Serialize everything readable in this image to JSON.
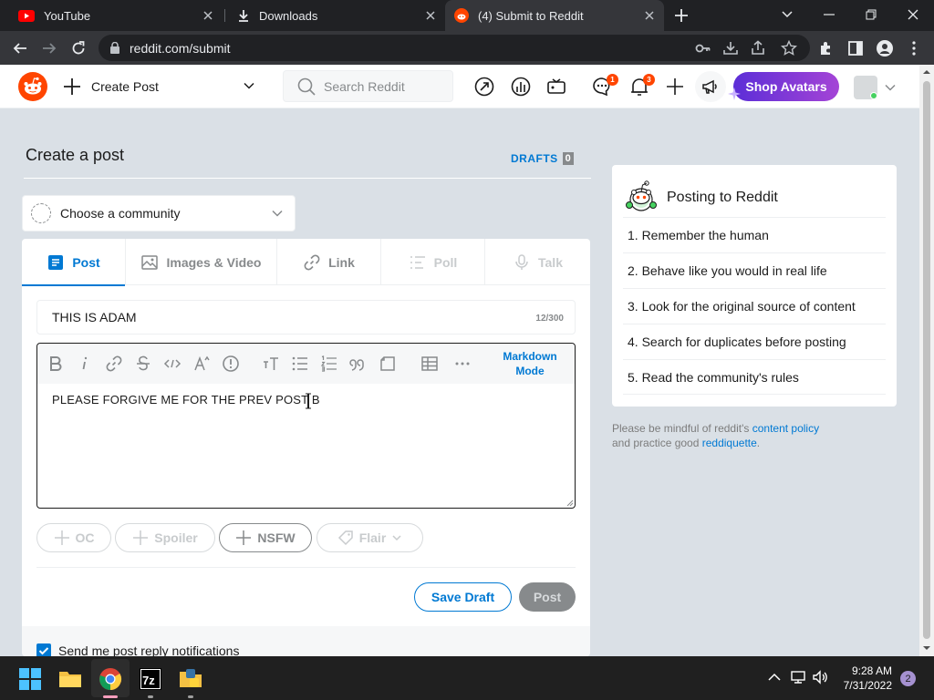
{
  "browser": {
    "tabs": [
      {
        "title": "YouTube",
        "icon": "youtube-icon"
      },
      {
        "title": "Downloads",
        "icon": "download-icon"
      },
      {
        "title": "(4) Submit to Reddit",
        "icon": "reddit-icon",
        "active": true
      }
    ],
    "url": "reddit.com/submit"
  },
  "header": {
    "create_post": "Create Post",
    "search_placeholder": "Search Reddit",
    "chat_badge": "1",
    "notif_badge": "3",
    "shop_avatars": "Shop Avatars"
  },
  "main": {
    "page_title": "Create a post",
    "drafts_label": "DRAFTS",
    "drafts_count": "0",
    "community_placeholder": "Choose a community",
    "tabs": [
      "Post",
      "Images & Video",
      "Link",
      "Poll",
      "Talk"
    ],
    "title_value": "THIS IS ADAM",
    "title_count": "12/300",
    "markdown_mode": "Markdown Mode",
    "body_text": "PLEASE FORGIVE ME FOR THE PREV POST B",
    "tags": [
      "OC",
      "Spoiler",
      "NSFW",
      "Flair"
    ],
    "save_draft": "Save Draft",
    "post": "Post",
    "notify_label": "Send me post reply notifications"
  },
  "sidebar": {
    "title": "Posting to Reddit",
    "rules": [
      "1. Remember the human",
      "2. Behave like you would in real life",
      "3. Look for the original source of content",
      "4. Search for duplicates before posting",
      "5. Read the community's rules"
    ],
    "mindful_prefix": "Please be mindful of reddit's",
    "content_policy": "content policy",
    "mindful_middle": "and practice good",
    "reddiquette": "reddiquette",
    "mindful_suffix": "."
  },
  "taskbar": {
    "time": "9:28 AM",
    "date": "7/31/2022",
    "notifications": "2"
  },
  "colors": {
    "reddit_orange": "#ff4500",
    "reddit_blue": "#0079d3",
    "background": "#dae0e6"
  }
}
